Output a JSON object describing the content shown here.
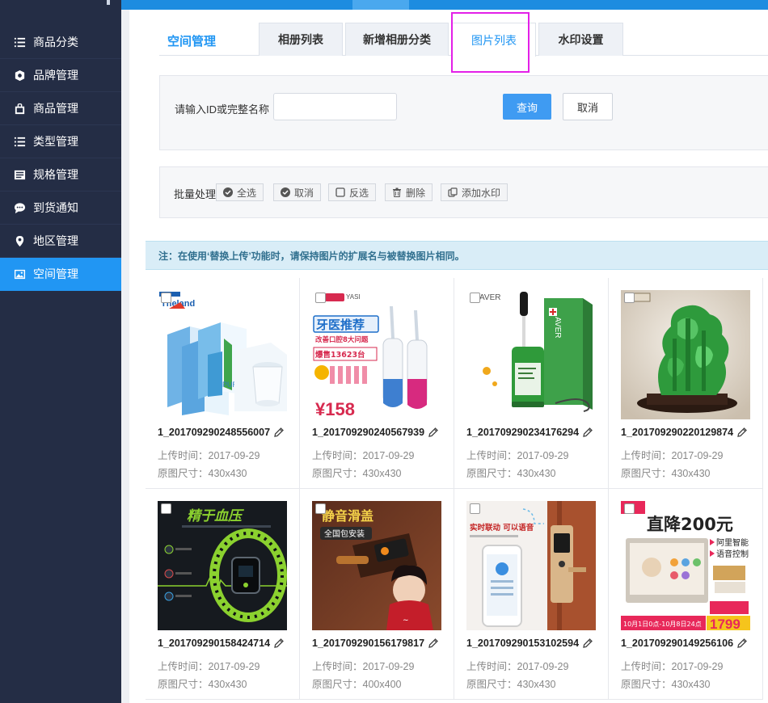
{
  "sidebar": {
    "items": [
      {
        "label": "商品分类",
        "icon": "list-icon"
      },
      {
        "label": "品牌管理",
        "icon": "badge-icon"
      },
      {
        "label": "商品管理",
        "icon": "bag-icon"
      },
      {
        "label": "类型管理",
        "icon": "list-icon"
      },
      {
        "label": "规格管理",
        "icon": "spec-icon"
      },
      {
        "label": "到货通知",
        "icon": "chat-icon"
      },
      {
        "label": "地区管理",
        "icon": "location-pin-icon"
      },
      {
        "label": "空间管理",
        "icon": "image-icon",
        "active": true
      }
    ]
  },
  "tabs": {
    "title": "空间管理",
    "items": [
      "相册列表",
      "新增相册分类",
      "图片列表",
      "水印设置"
    ],
    "active": "图片列表"
  },
  "search": {
    "label": "请输入ID或完整名称",
    "value": "",
    "query_label": "查询",
    "cancel_label": "取消"
  },
  "batch": {
    "label": "批量处理",
    "buttons": [
      "全选",
      "取消",
      "反选",
      "删除",
      "添加水印"
    ]
  },
  "notice": "注：在使用‘替换上传’功能时，请保持图片的扩展名与被替换图片相同。",
  "images": [
    {
      "name": "1_201709290248556007",
      "upload_label": "上传时间：",
      "upload_date": "2017-09-29",
      "size_label": "原图尺寸：",
      "size": "430x430"
    },
    {
      "name": "1_201709290240567939",
      "upload_label": "上传时间：",
      "upload_date": "2017-09-29",
      "size_label": "原图尺寸：",
      "size": "430x430"
    },
    {
      "name": "1_201709290234176294",
      "upload_label": "上传时间：",
      "upload_date": "2017-09-29",
      "size_label": "原图尺寸：",
      "size": "430x430"
    },
    {
      "name": "1_201709290220129874",
      "upload_label": "上传时间：",
      "upload_date": "2017-09-29",
      "size_label": "原图尺寸：",
      "size": "430x430"
    },
    {
      "name": "1_201709290158424714",
      "upload_label": "上传时间：",
      "upload_date": "2017-09-29",
      "size_label": "原图尺寸：",
      "size": "430x430"
    },
    {
      "name": "1_201709290156179817",
      "upload_label": "上传时间：",
      "upload_date": "2017-09-29",
      "size_label": "原图尺寸：",
      "size": "400x400"
    },
    {
      "name": "1_201709290153102594",
      "upload_label": "上传时间：",
      "upload_date": "2017-09-29",
      "size_label": "原图尺寸：",
      "size": "430x430"
    },
    {
      "name": "1_201709290149256106",
      "upload_label": "上传时间：",
      "upload_date": "2017-09-29",
      "size_label": "原图尺寸：",
      "size": "430x430"
    }
  ],
  "image_art": {
    "milk_brand": "Theland",
    "milk_text": "PURE MILK",
    "irrigator_brand": "YASI",
    "irrigator_title": "牙医推荐",
    "irrigator_sub": "改善口腔8大问题",
    "irrigator_sales": "爆售13623台",
    "irrigator_price": "¥158",
    "serum_brand": "AVER",
    "bracelet_title": "精于血压",
    "lock_title": "静音滑盖",
    "lock_sub": "全国包安装",
    "doorlock_title": "实时联动 可以语音",
    "panel_title": "直降200元",
    "panel_line1": "阿里智能",
    "panel_line2": "语音控制",
    "panel_date": "10月1日0点-10月8日24点",
    "panel_price": "1799"
  },
  "colors": {
    "sidebar_bg": "#242d45",
    "accent": "#2196f3",
    "notice_bg": "#d9edf7",
    "highlight": "#e320e8"
  }
}
